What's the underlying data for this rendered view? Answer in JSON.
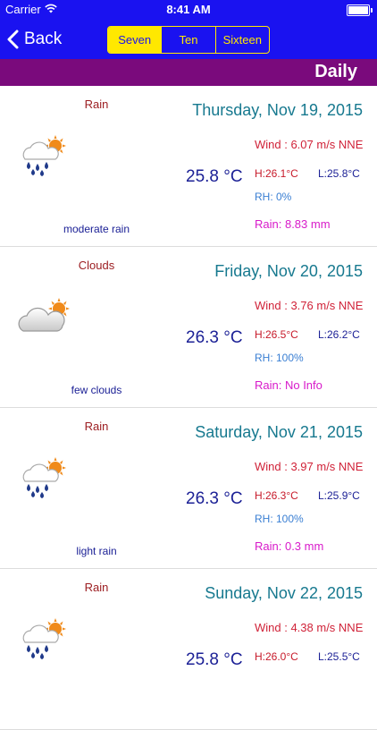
{
  "status": {
    "carrier": "Carrier",
    "time": "8:41 AM"
  },
  "nav": {
    "back_label": "Back",
    "segments": [
      "Seven",
      "Ten",
      "Sixteen"
    ],
    "selected": "Seven"
  },
  "section": {
    "title": "Daily"
  },
  "days": [
    {
      "condition": "Rain",
      "date": "Thursday, Nov 19, 2015",
      "icon": "rain-cloud-sun-icon",
      "temp": "25.8 °C",
      "description": "moderate rain",
      "wind": "Wind : 6.07 m/s NNE",
      "high": "H:26.1°C",
      "low": "L:25.8°C",
      "rh": "RH: 0%",
      "rain": "Rain: 8.83 mm"
    },
    {
      "condition": "Clouds",
      "date": "Friday, Nov 20, 2015",
      "icon": "cloud-sun-icon",
      "temp": "26.3 °C",
      "description": "few clouds",
      "wind": "Wind : 3.76 m/s NNE",
      "high": "H:26.5°C",
      "low": "L:26.2°C",
      "rh": "RH: 100%",
      "rain": "Rain: No Info"
    },
    {
      "condition": "Rain",
      "date": "Saturday, Nov 21, 2015",
      "icon": "rain-cloud-sun-icon",
      "temp": "26.3 °C",
      "description": "light rain",
      "wind": "Wind : 3.97 m/s NNE",
      "high": "H:26.3°C",
      "low": "L:25.9°C",
      "rh": "RH: 100%",
      "rain": "Rain: 0.3 mm"
    },
    {
      "condition": "Rain",
      "date": "Sunday, Nov 22, 2015",
      "icon": "rain-cloud-sun-icon",
      "temp": "25.8 °C",
      "description": "",
      "wind": "Wind : 4.38 m/s NNE",
      "high": "H:26.0°C",
      "low": "L:25.5°C",
      "rh": "",
      "rain": ""
    }
  ]
}
